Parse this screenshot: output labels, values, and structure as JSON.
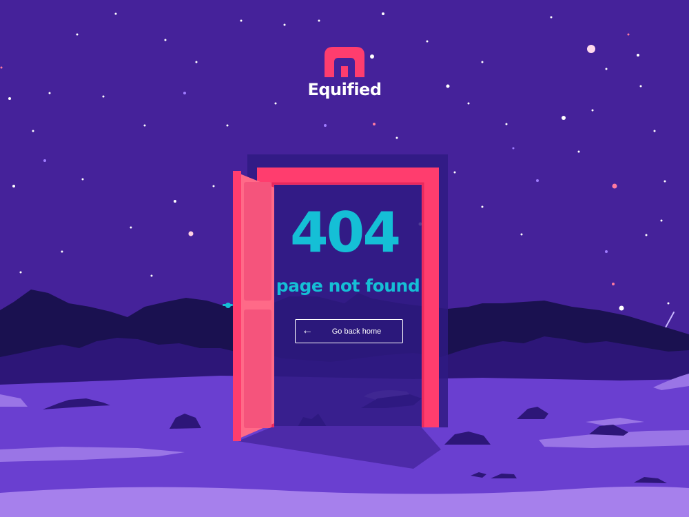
{
  "brand": {
    "name": "Equified",
    "logo_icon": "house-icon",
    "logo_color": "#ff3d6e"
  },
  "error": {
    "code": "404",
    "message": "page not found"
  },
  "actions": {
    "home_label": "Go back home",
    "home_icon": "arrow-left-icon"
  },
  "colors": {
    "sky": "#45229a",
    "accent": "#15bfd6",
    "door": "#ff3d6e",
    "ground": "#6a3fd0"
  }
}
